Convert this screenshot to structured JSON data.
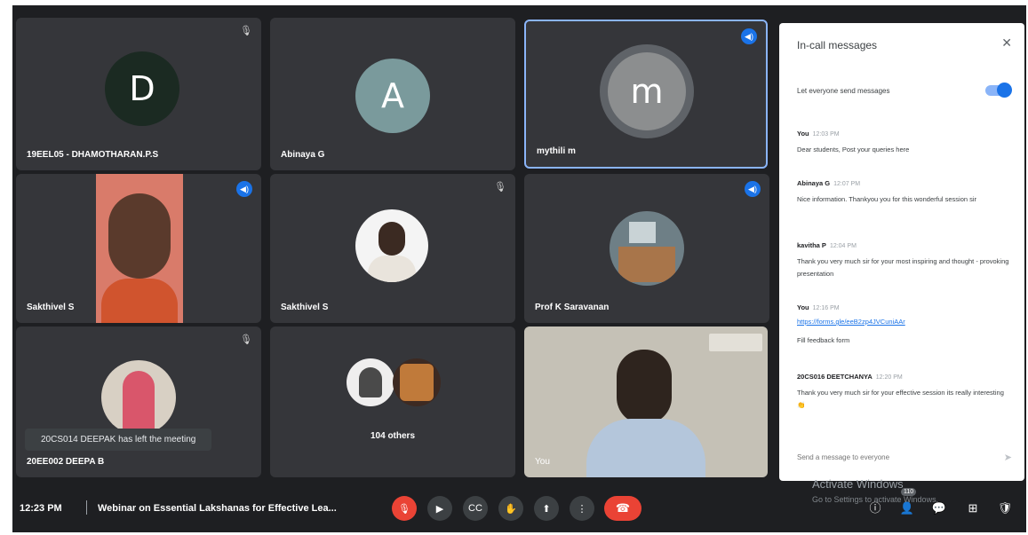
{
  "participants": [
    {
      "name": "19EEL05 - DHAMOTHARAN.P.S",
      "initial": "D",
      "status": "muted",
      "avatar_color": "#1b2a22"
    },
    {
      "name": "Abinaya G",
      "initial": "A",
      "status": "none",
      "avatar_color": "#7a9a9c"
    },
    {
      "name": "mythili m",
      "initial": "m",
      "status": "speaking",
      "avatar_color": "#8c8e8f"
    },
    {
      "name": "Sakthivel S",
      "status": "speaking"
    },
    {
      "name": "Sakthivel S",
      "status": "muted"
    },
    {
      "name": "Prof K Saravanan",
      "status": "speaking"
    },
    {
      "name": "20EE002 DEEPA B",
      "status": "muted"
    },
    {
      "name": "104 others"
    },
    {
      "name": "You"
    }
  ],
  "toast": "20CS014 DEEPAK has left the meeting",
  "chat": {
    "title": "In-call messages",
    "toggle_label": "Let everyone send messages",
    "messages": [
      {
        "sender": "You",
        "time": "12:03 PM",
        "text": "Dear students, Post your queries  here"
      },
      {
        "sender": "Abinaya G",
        "time": "12:07 PM",
        "text": "Nice information. Thankyou you for this wonderful session sir"
      },
      {
        "sender": "kavitha P",
        "time": "12:04 PM",
        "text": "Thank you very much sir for your  most inspiring and thought - provoking presentation"
      },
      {
        "sender": "You",
        "time": "12:16 PM",
        "link": "https://forms.gle/eeB2zp4JVCuniAAr",
        "text": "Fill feedback form"
      },
      {
        "sender": "20CS016 DEETCHANYA",
        "time": "12:20 PM",
        "text": "Thank you very much sir for your effective session its really interesting 👏"
      }
    ],
    "input_placeholder": "Send a message to everyone"
  },
  "bottom_bar": {
    "time": "12:23 PM",
    "meeting_title": "Webinar on Essential Lakshanas for Effective Lea...",
    "people_count": "110"
  },
  "watermark": {
    "line1": "Activate Windows",
    "line2": "Go to Settings to activate Windows."
  },
  "colors": {
    "background": "#1e1f22",
    "tile": "#35363a",
    "accent": "#1a73e8",
    "danger": "#ea4335"
  }
}
